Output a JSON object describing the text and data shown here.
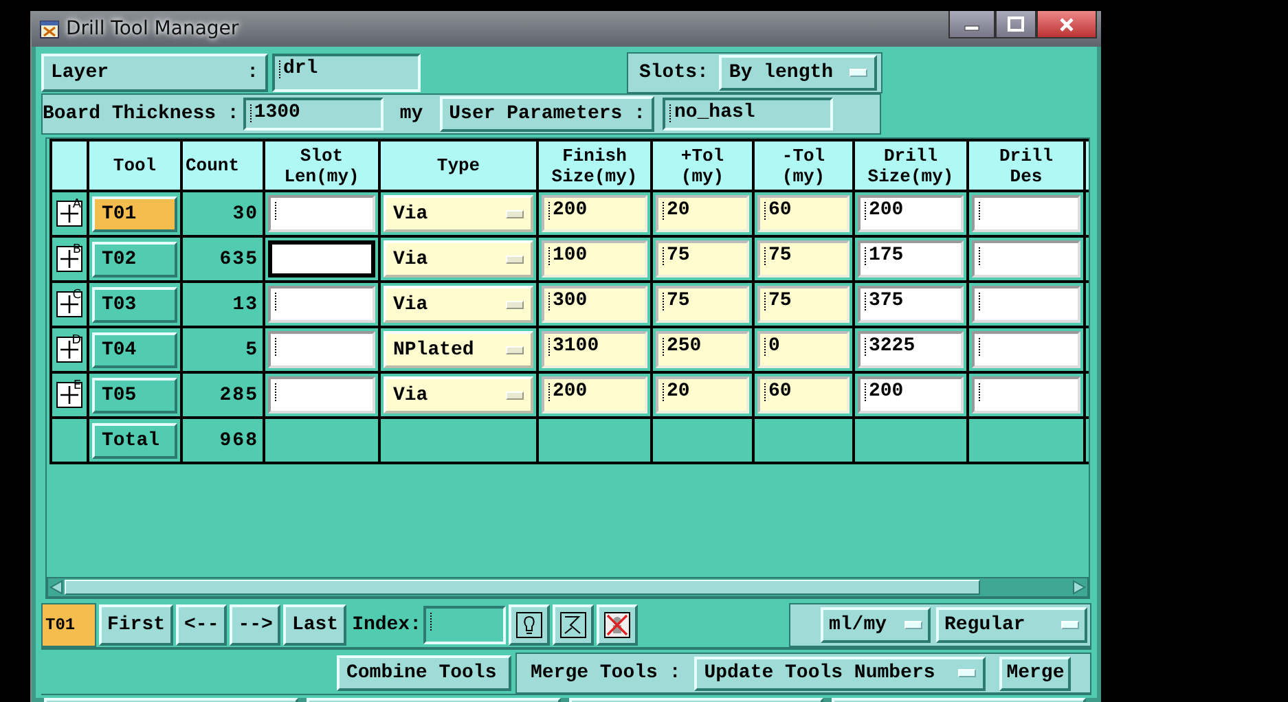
{
  "window": {
    "title": "Drill Tool Manager"
  },
  "layer": {
    "label": "Layer",
    "colon": ":",
    "value": "drl"
  },
  "slots": {
    "label": "Slots:",
    "value": "By length"
  },
  "board_thickness": {
    "label": "Board Thickness :",
    "value": "1300",
    "unit": "my"
  },
  "user_parameters": {
    "label": "User Parameters :",
    "value": "no_hasl"
  },
  "table": {
    "columns": [
      [
        "Tool"
      ],
      [
        "Count"
      ],
      [
        "Slot",
        "Len(my)"
      ],
      [
        "Type"
      ],
      [
        "Finish",
        "Size(my)"
      ],
      [
        "+Tol",
        "(my)"
      ],
      [
        "-Tol",
        "(my)"
      ],
      [
        "Drill",
        "Size(my)"
      ],
      [
        "Drill",
        "Des"
      ]
    ],
    "rows": [
      {
        "marker": "A",
        "tool": "T01",
        "selected": true,
        "count": "30",
        "focused": false,
        "type": "Via",
        "finish": "200",
        "plus_tol": "20",
        "minus_tol": "60",
        "drill_size": "200"
      },
      {
        "marker": "B",
        "tool": "T02",
        "selected": false,
        "count": "635",
        "focused": true,
        "type": "Via",
        "finish": "100",
        "plus_tol": "75",
        "minus_tol": "75",
        "drill_size": "175"
      },
      {
        "marker": "C",
        "tool": "T03",
        "selected": false,
        "count": "13",
        "focused": false,
        "type": "Via",
        "finish": "300",
        "plus_tol": "75",
        "minus_tol": "75",
        "drill_size": "375"
      },
      {
        "marker": "D",
        "tool": "T04",
        "selected": false,
        "count": "5",
        "focused": false,
        "type": "NPlated",
        "finish": "3100",
        "plus_tol": "250",
        "minus_tol": "0",
        "drill_size": "3225"
      },
      {
        "marker": "E",
        "tool": "T05",
        "selected": false,
        "count": "285",
        "focused": false,
        "type": "Via",
        "finish": "200",
        "plus_tol": "20",
        "minus_tol": "60",
        "drill_size": "200"
      }
    ],
    "total": {
      "label": "Total",
      "count": "968"
    }
  },
  "navigation": {
    "current": "T01",
    "buttons": [
      "First",
      "<--",
      "-->",
      "Last"
    ],
    "index_label": "Index:",
    "units": "ml/my",
    "mode": "Regular"
  },
  "actions": {
    "combine": "Combine Tools",
    "merge_label": "Merge Tools :",
    "merge_mode": "Update Tools Numbers",
    "merge": "Merge"
  }
}
